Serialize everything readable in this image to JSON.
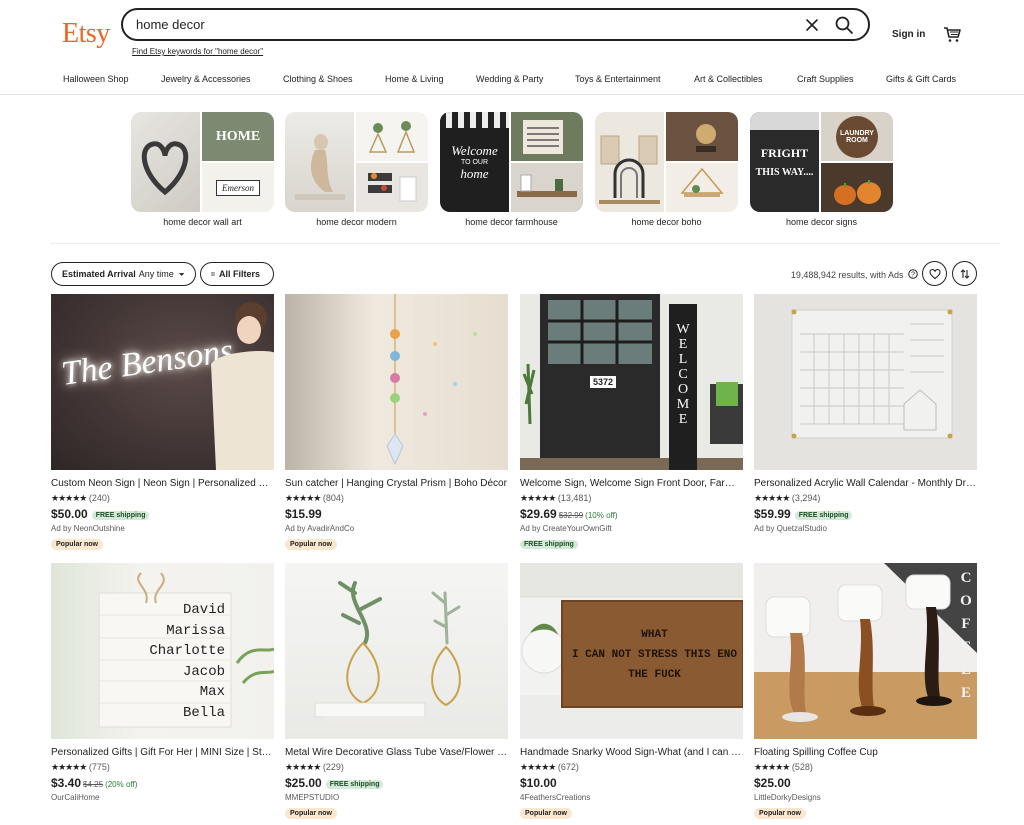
{
  "header": {
    "logo": "Etsy",
    "search_value": "home decor",
    "keywords_link": "Find Etsy keywords for \"home decor\"",
    "sign_in": "Sign in"
  },
  "nav": [
    "Halloween Shop",
    "Jewelry & Accessories",
    "Clothing & Shoes",
    "Home & Living",
    "Wedding & Party",
    "Toys & Entertainment",
    "Art & Collectibles",
    "Craft Supplies",
    "Gifts & Gift Cards"
  ],
  "related": [
    {
      "label": "home decor wall art"
    },
    {
      "label": "home decor modern"
    },
    {
      "label": "home decor farmhouse"
    },
    {
      "label": "home decor boho"
    },
    {
      "label": "home decor signs"
    }
  ],
  "filters": {
    "arrival_label": "Estimated Arrival",
    "arrival_value": "Any time",
    "all_filters": "All Filters",
    "results": "19,488,942 results, with Ads"
  },
  "image_text": {
    "neon": "The Bensons",
    "welcome": "WELCOME",
    "door_number": "5372",
    "wood_sign": [
      "WHAT",
      "I CAN NOT STRESS THIS ENO",
      "THE FUCK"
    ],
    "names": [
      "David",
      "Marissa",
      "Charlotte",
      "Jacob",
      "Max",
      "Bella"
    ],
    "coffee": "COFFEE",
    "home": "HOME",
    "emerson": "Emerson",
    "welcome_chalk": [
      "Welcome",
      "TO OUR",
      "home"
    ],
    "fright": [
      "FRIGHT",
      "THIS WAY...."
    ],
    "laundry": [
      "LAUNDRY",
      "ROOM"
    ]
  },
  "listings": [
    {
      "title": "Custom Neon Sign | Neon Sign | Personalized Gift",
      "stars": "★★★★★",
      "count": "(240)",
      "price": "$50.00",
      "free": "FREE shipping",
      "seller": "Ad by NeonOutshine",
      "badge": "Popular now"
    },
    {
      "title": "Sun catcher | Hanging Crystal Prism | Boho Décor",
      "stars": "★★★★★",
      "count": "(804)",
      "price": "$15.99",
      "seller": "Ad by AvadirAndCo",
      "badge": "Popular now"
    },
    {
      "title": "Welcome Sign, Welcome Sign Front Door, Farmhouse",
      "stars": "★★★★★",
      "count": "(13,481)",
      "price": "$29.69",
      "orig": "$32.99",
      "disc": "(10% off)",
      "seller": "Ad by CreateYourOwnGift",
      "free_block": "FREE shipping"
    },
    {
      "title": "Personalized Acrylic Wall Calendar - Monthly Dry Erase",
      "stars": "★★★★★",
      "count": "(3,294)",
      "price": "$59.99",
      "free": "FREE shipping",
      "seller": "Ad by QuetzalStudio"
    },
    {
      "title": "Personalized Gifts | Gift For Her | MINI Size | Stacked Books",
      "stars": "★★★★★",
      "count": "(775)",
      "price": "$3.40",
      "orig": "$4.25",
      "disc": "(20% off)",
      "seller": "OurCaliHome"
    },
    {
      "title": "Metal Wire Decorative Glass Tube Vase/Flower Pot",
      "stars": "★★★★★",
      "count": "(229)",
      "price": "$25.00",
      "free": "FREE shipping",
      "seller": "MMEPSTUDIO",
      "badge": "Popular now"
    },
    {
      "title": "Handmade Snarky Wood Sign-What (and I can not stress this enough)",
      "stars": "★★★★★",
      "count": "(672)",
      "price": "$10.00",
      "seller": "4FeathersCreations",
      "badge": "Popular now"
    },
    {
      "title": "Floating Spilling Coffee Cup",
      "stars": "★★★★★",
      "count": "(528)",
      "price": "$25.00",
      "seller": "LittleDorkyDesigns",
      "badge": "Popular now"
    }
  ]
}
